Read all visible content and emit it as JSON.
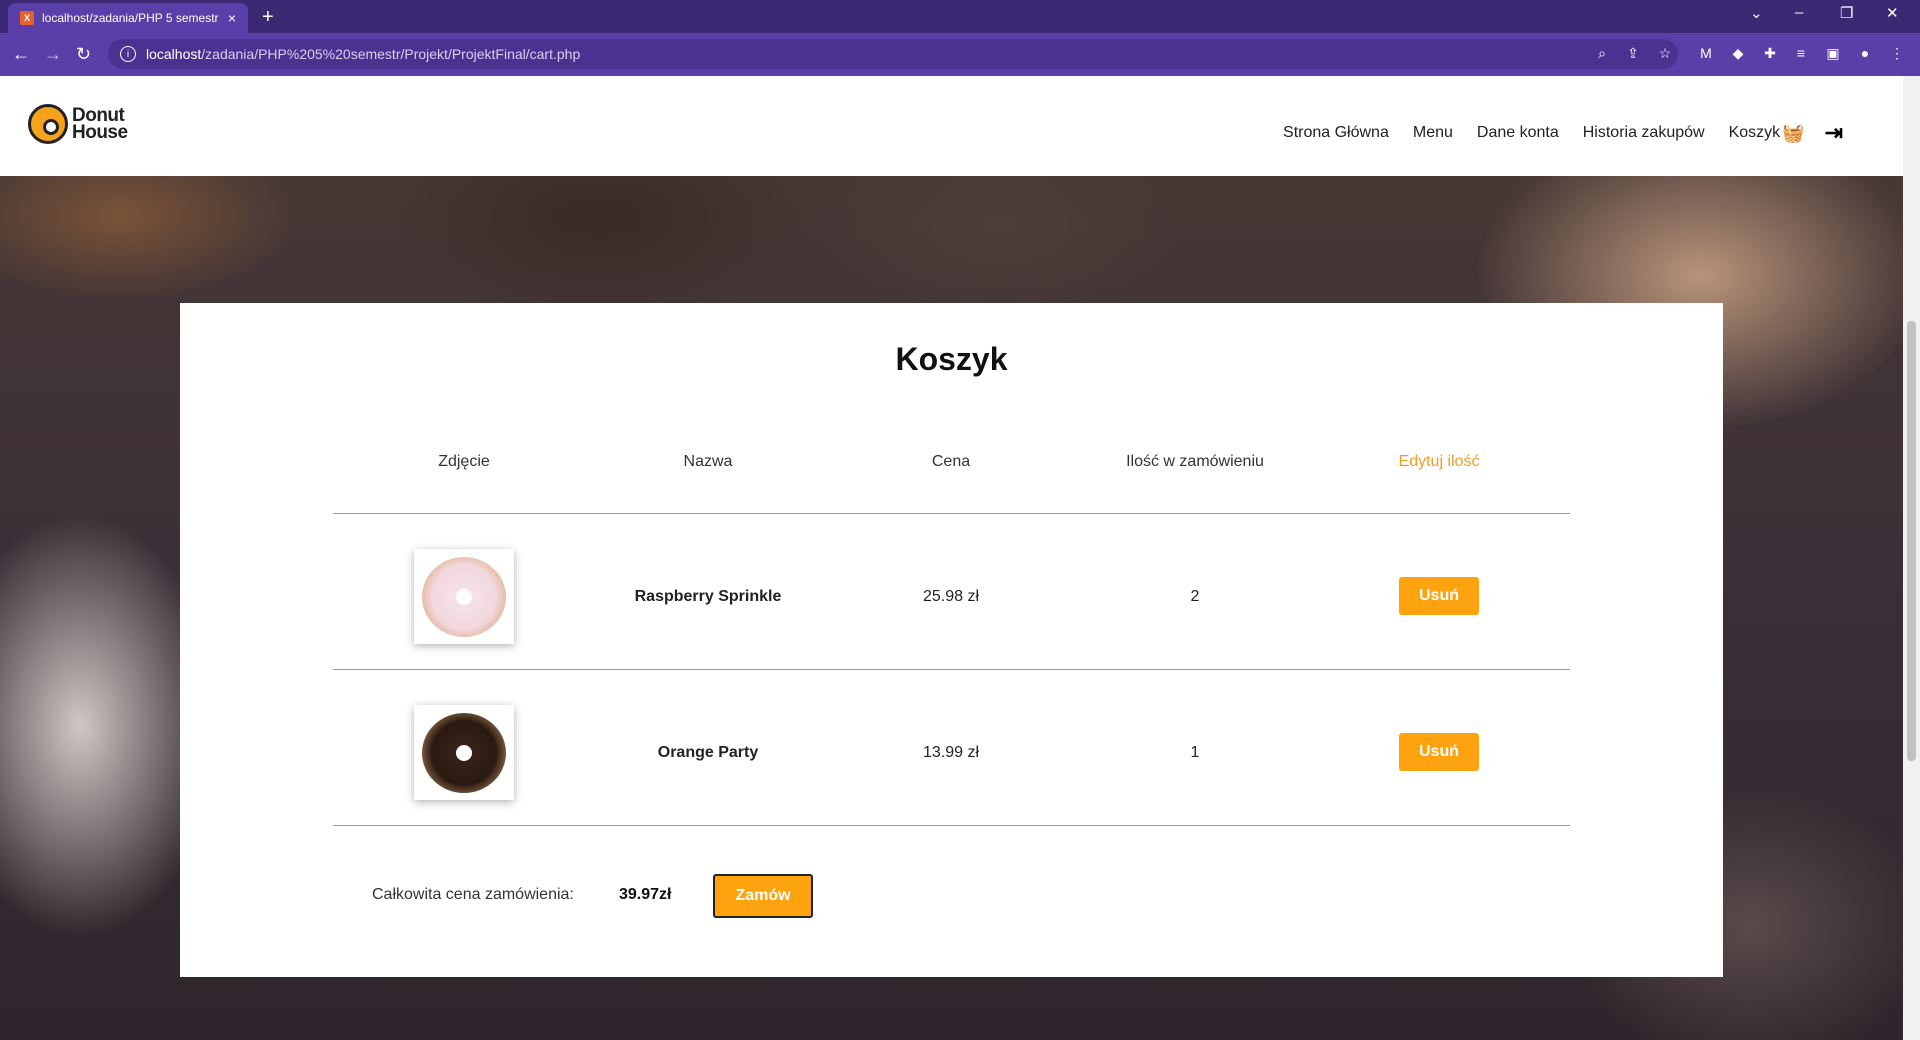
{
  "browser": {
    "tab_title": "localhost/zadania/PHP 5 semestr",
    "tab_close": "×",
    "new_tab": "+",
    "url_host": "localhost",
    "url_path": "/zadania/PHP%205%20semestr/Projekt/ProjektFinal/cart.php"
  },
  "header": {
    "logo_line1": "Donut",
    "logo_line2": "House",
    "nav": {
      "home": "Strona Główna",
      "menu": "Menu",
      "account": "Dane konta",
      "history": "Historia zakupów",
      "cart": "Koszyk"
    }
  },
  "cart": {
    "title": "Koszyk",
    "columns": {
      "image": "Zdjęcie",
      "name": "Nazwa",
      "price": "Cena",
      "quantity": "Ilość w zamówieniu",
      "edit": "Edytuj ilość"
    },
    "items": [
      {
        "name": "Raspberry Sprinkle",
        "price": "25.98 zł",
        "quantity": "2",
        "remove_label": "Usuń"
      },
      {
        "name": "Orange Party",
        "price": "13.99 zł",
        "quantity": "1",
        "remove_label": "Usuń"
      }
    ],
    "total_label": "Całkowita cena zamówienia:",
    "total_value": "39.97zł",
    "order_label": "Zamów"
  }
}
